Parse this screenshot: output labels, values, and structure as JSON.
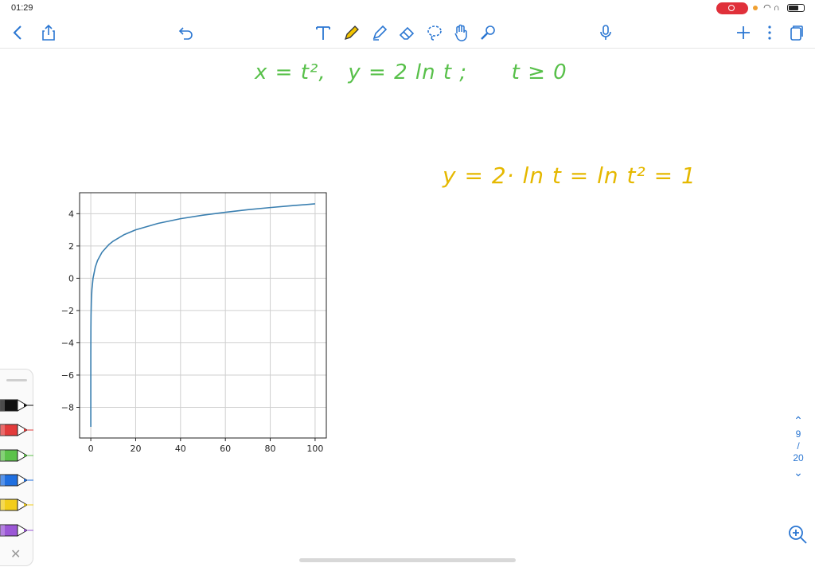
{
  "status_bar": {
    "time": "01:29"
  },
  "toolbar": {
    "icons": [
      "chevron-left-icon",
      "share-icon",
      "undo-icon",
      "text-tool-icon",
      "pencil-icon",
      "highlighter-icon",
      "eraser-icon",
      "lasso-icon",
      "hand-pointer-icon",
      "laser-pointer-icon",
      "microphone-icon",
      "plus-icon",
      "more-vertical-icon",
      "pages-icon"
    ],
    "accent_color": "#2a76d2"
  },
  "notes": {
    "green_line": "x = t²,   y = 2 ln t ;      t ≥ 0",
    "yellow_line": "y = 2· ln t = ln t² = 1",
    "green_color": "#58c04a",
    "yellow_color": "#e5b800"
  },
  "chart_data": {
    "type": "line",
    "title": "",
    "xlabel": "",
    "ylabel": "",
    "x_ticks": [
      "0",
      "20",
      "40",
      "60",
      "80",
      "100"
    ],
    "y_ticks": [
      "4",
      "2",
      "0",
      "−2",
      "−4",
      "−6",
      "−8"
    ],
    "xlim": [
      -5,
      105
    ],
    "ylim": [
      -9.9,
      5.3
    ],
    "grid": true,
    "series": [
      {
        "color": "#3a7fb0",
        "x": [
          0.0001,
          0.001,
          0.01,
          0.05,
          0.1,
          0.25,
          0.5,
          1,
          2,
          3,
          5,
          8,
          10,
          15,
          20,
          30,
          40,
          50,
          60,
          70,
          80,
          90,
          100
        ],
        "y": [
          -9.21,
          -6.91,
          -4.61,
          -3.0,
          -2.3,
          -1.39,
          -0.69,
          0,
          0.69,
          1.1,
          1.61,
          2.08,
          2.3,
          2.71,
          3.0,
          3.4,
          3.69,
          3.91,
          4.09,
          4.25,
          4.38,
          4.5,
          4.61
        ]
      }
    ]
  },
  "pen_tray": {
    "pens": [
      {
        "name": "black",
        "color": "#111111"
      },
      {
        "name": "red",
        "color": "#e23b3b"
      },
      {
        "name": "green",
        "color": "#5cc24a"
      },
      {
        "name": "blue",
        "color": "#1f6fe0"
      },
      {
        "name": "yellow",
        "color": "#f2cd1b"
      },
      {
        "name": "purple",
        "color": "#9b57d6"
      }
    ],
    "close_label": "✕"
  },
  "pager": {
    "up": "⌃",
    "current": "9",
    "separator": "/",
    "total": "20",
    "down": "⌄"
  }
}
